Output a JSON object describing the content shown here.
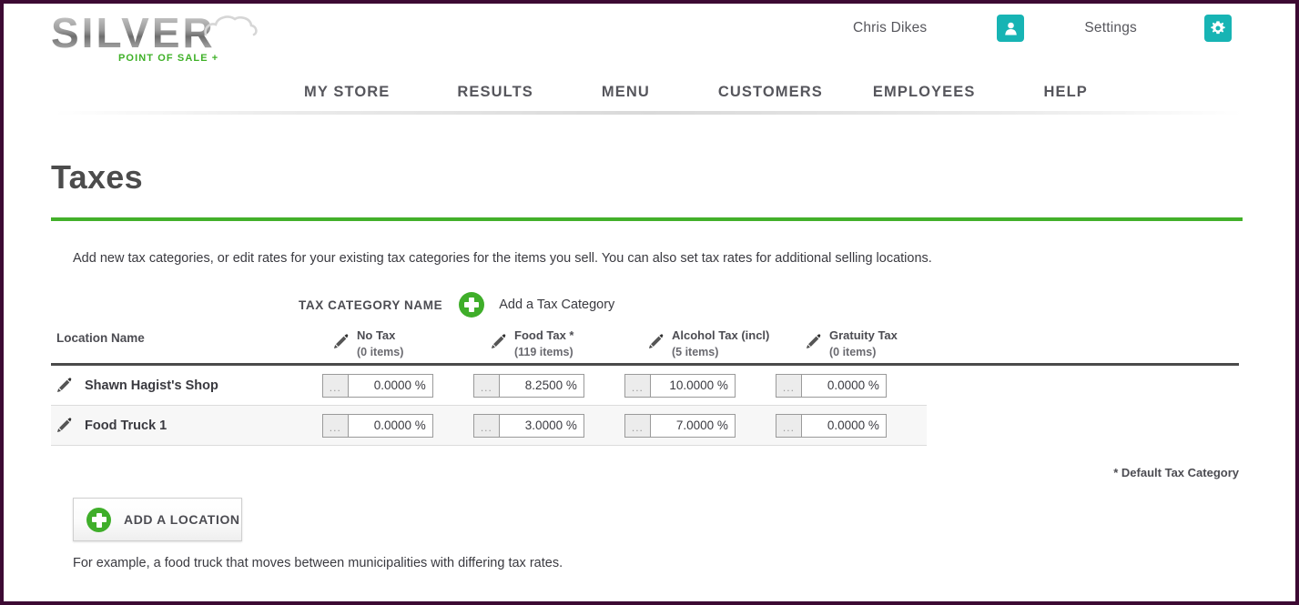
{
  "brand": {
    "logo_word": "SILVER",
    "logo_tagline": "POINT OF SALE +",
    "green": "#43b02a",
    "teal": "#17b4b4",
    "border": "#3d0a33"
  },
  "account": {
    "user_name": "Chris Dikes",
    "user_icon": "user-icon",
    "settings_label": "Settings",
    "settings_icon": "gear-icon"
  },
  "nav": {
    "items": [
      {
        "label": "MY STORE"
      },
      {
        "label": "RESULTS"
      },
      {
        "label": "MENU"
      },
      {
        "label": "CUSTOMERS"
      },
      {
        "label": "EMPLOYEES"
      },
      {
        "label": "HELP"
      }
    ]
  },
  "page": {
    "title": "Taxes",
    "intro": "Add new tax categories, or edit rates for your existing tax categories for the items you sell. You can also set tax rates for additional selling locations."
  },
  "category_add": {
    "label": "TAX CATEGORY NAME",
    "plus_icon": "plus-circle-icon",
    "action_label": "Add a Tax Category"
  },
  "table": {
    "location_header": "Location Name",
    "edit_icon": "pencil-icon",
    "ellipsis_label": "...",
    "columns": [
      {
        "name": "No Tax",
        "count": "(0 items)"
      },
      {
        "name": "Food Tax *",
        "count": "(119 items)"
      },
      {
        "name": "Alcohol Tax (incl)",
        "count": "(5 items)"
      },
      {
        "name": "Gratuity Tax",
        "count": "(0 items)"
      }
    ],
    "rows": [
      {
        "location": "Shawn Hagist's Shop",
        "rates": [
          "0.0000 %",
          "8.2500 %",
          "10.0000 %",
          "0.0000 %"
        ]
      },
      {
        "location": "Food Truck 1",
        "rates": [
          "0.0000 %",
          "3.0000 %",
          "7.0000 %",
          "0.0000 %"
        ]
      }
    ]
  },
  "footer": {
    "default_note": "* Default Tax Category",
    "add_location_label": "ADD A LOCATION",
    "add_location_icon": "plus-circle-icon",
    "example_text": "For example, a food truck that moves between municipalities with differing tax rates."
  }
}
